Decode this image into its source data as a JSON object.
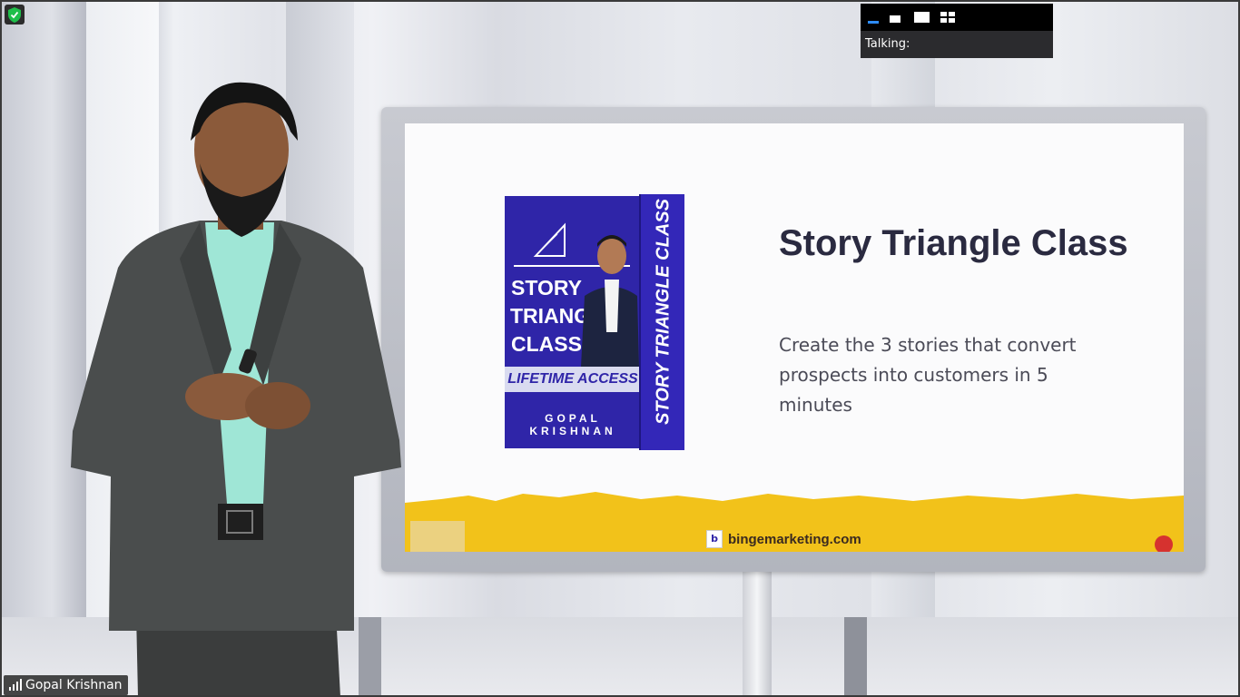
{
  "window": {
    "type": "video-meeting-tile"
  },
  "view_switcher": {
    "buttons": [
      {
        "name": "minimize-view",
        "icon": "minimize-view-icon"
      },
      {
        "name": "thumbnail-view",
        "icon": "thumbnail-view-icon"
      },
      {
        "name": "speaker-view",
        "icon": "speaker-view-icon"
      },
      {
        "name": "gallery-view",
        "icon": "gallery-view-icon"
      }
    ],
    "talking_label": "Talking:"
  },
  "participant": {
    "name": "Gopal Krishnan",
    "signal_icon": "signal-bars-icon"
  },
  "security_badge": {
    "icon": "shield-check-icon",
    "color": "#1fbf4a"
  },
  "slide": {
    "title": "Story Triangle Class",
    "description": "Create the 3 stories that convert prospects into customers in 5 minutes",
    "product_box": {
      "title": "STORY TRIANGLE CLASS",
      "lifetime": "LIFETIME ACCESS",
      "author": "GOPAL KRISHNAN",
      "side_text": "STORY TRIANGLE CLASS",
      "color": "#2f25a8"
    },
    "footer": {
      "url": "bingemarketing.com",
      "band_color": "#f2c21a"
    }
  }
}
